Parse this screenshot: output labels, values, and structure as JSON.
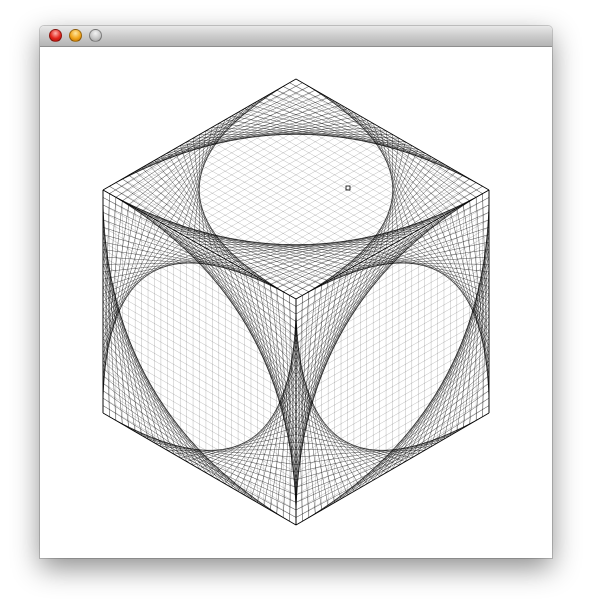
{
  "window": {
    "title": "",
    "controls": [
      {
        "name": "close",
        "color": "#e2241b"
      },
      {
        "name": "minimize",
        "color": "#f1a51a"
      },
      {
        "name": "zoom",
        "color": "#c6c6c6"
      }
    ]
  },
  "drawing": {
    "shape": "string-art cube",
    "line_color": "#000000",
    "background": "#ffffff",
    "divisions": 30
  }
}
